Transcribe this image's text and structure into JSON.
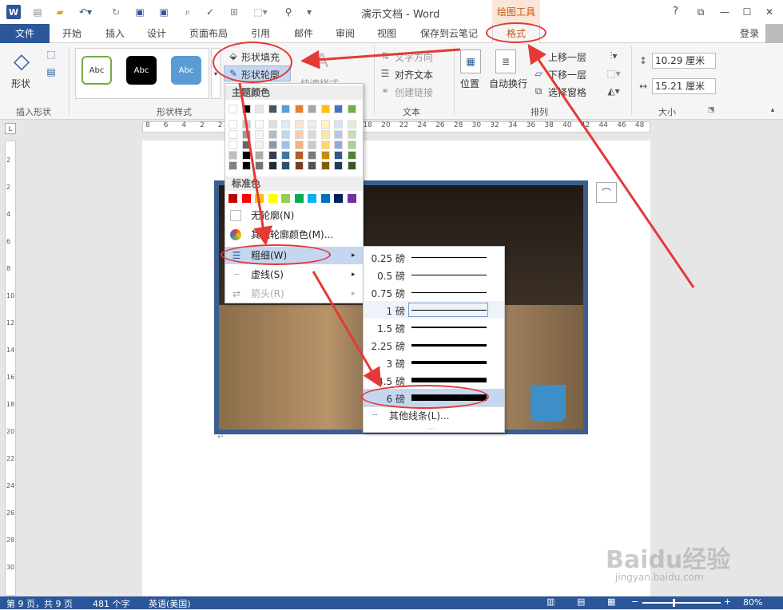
{
  "title_bar": {
    "title": "演示文档 - Word",
    "drawing_tools": "绘图工具",
    "help": "?"
  },
  "tabs": [
    {
      "label": "文件"
    },
    {
      "label": "开始"
    },
    {
      "label": "插入"
    },
    {
      "label": "设计"
    },
    {
      "label": "页面布局"
    },
    {
      "label": "引用"
    },
    {
      "label": "邮件"
    },
    {
      "label": "审阅"
    },
    {
      "label": "视图"
    },
    {
      "label": "保存到云笔记"
    },
    {
      "label": "格式"
    }
  ],
  "login": "登录",
  "ribbon": {
    "shape_label": "形状",
    "insert_shape_group": "插入形状",
    "style_preset": "Abc",
    "shape_style_group": "形状样式",
    "shape_fill": "形状填充",
    "shape_outline": "形状轮廓",
    "quick_style": "快速样式",
    "text_direction": "文字方向",
    "align_text": "对齐文本",
    "create_link": "创建链接",
    "text_group": "文本",
    "position": "位置",
    "wrap": "自动换行",
    "bring_forward": "上移一层",
    "send_backward": "下移一层",
    "selection_pane": "选择窗格",
    "arrange_group": "排列",
    "height": "10.29 厘米",
    "width": "15.21 厘米",
    "size_group": "大小"
  },
  "ruler_nums": [
    "8",
    "6",
    "4",
    "2",
    "2",
    "4",
    "6",
    "8",
    "10",
    "12",
    "14",
    "16",
    "18",
    "20",
    "22",
    "24",
    "26",
    "28",
    "30",
    "32",
    "34",
    "36",
    "38",
    "40",
    "42",
    "44",
    "46",
    "48"
  ],
  "vruler_nums": [
    "2",
    "2",
    "4",
    "6",
    "8",
    "10",
    "12",
    "14",
    "16",
    "18",
    "20",
    "22",
    "24",
    "26",
    "28",
    "30"
  ],
  "outline_menu": {
    "theme_colors": "主题颜色",
    "standard_colors": "标准色",
    "no_outline": "无轮廓(N)",
    "more_colors": "其他轮廓颜色(M)...",
    "weight": "粗细(W)",
    "dashes": "虚线(S)",
    "arrows": "箭头(R)"
  },
  "theme_color_top": [
    "#ffffff",
    "#000000",
    "#e7e6e6",
    "#44546a",
    "#5b9bd5",
    "#ed7d31",
    "#a5a5a5",
    "#ffc000",
    "#4472c4",
    "#70ad47"
  ],
  "standard_colors": [
    "#c00000",
    "#ff0000",
    "#ffc000",
    "#ffff00",
    "#92d050",
    "#00b050",
    "#00b0f0",
    "#0070c0",
    "#002060",
    "#7030a0"
  ],
  "weights": [
    {
      "label": "0.25 磅",
      "w": 0.25
    },
    {
      "label": "0.5 磅",
      "w": 0.5
    },
    {
      "label": "0.75 磅",
      "w": 0.75
    },
    {
      "label": "1 磅",
      "w": 1
    },
    {
      "label": "1.5 磅",
      "w": 1.5
    },
    {
      "label": "2.25 磅",
      "w": 2.25
    },
    {
      "label": "3 磅",
      "w": 3
    },
    {
      "label": "4.5 磅",
      "w": 4.5
    },
    {
      "label": "6 磅",
      "w": 6
    }
  ],
  "more_lines": "其他线条(L)...",
  "status": {
    "page": "第 9 页，共 9 页",
    "words": "481 个字",
    "lang": "英语(美国)",
    "zoom": "80%"
  },
  "watermark": {
    "brand": "Baidu经验",
    "url": "jingyan.baidu.com"
  },
  "colors": {
    "accent": "#2b579a",
    "tab_orange": "#c55a11",
    "annotation_red": "#e53935"
  }
}
